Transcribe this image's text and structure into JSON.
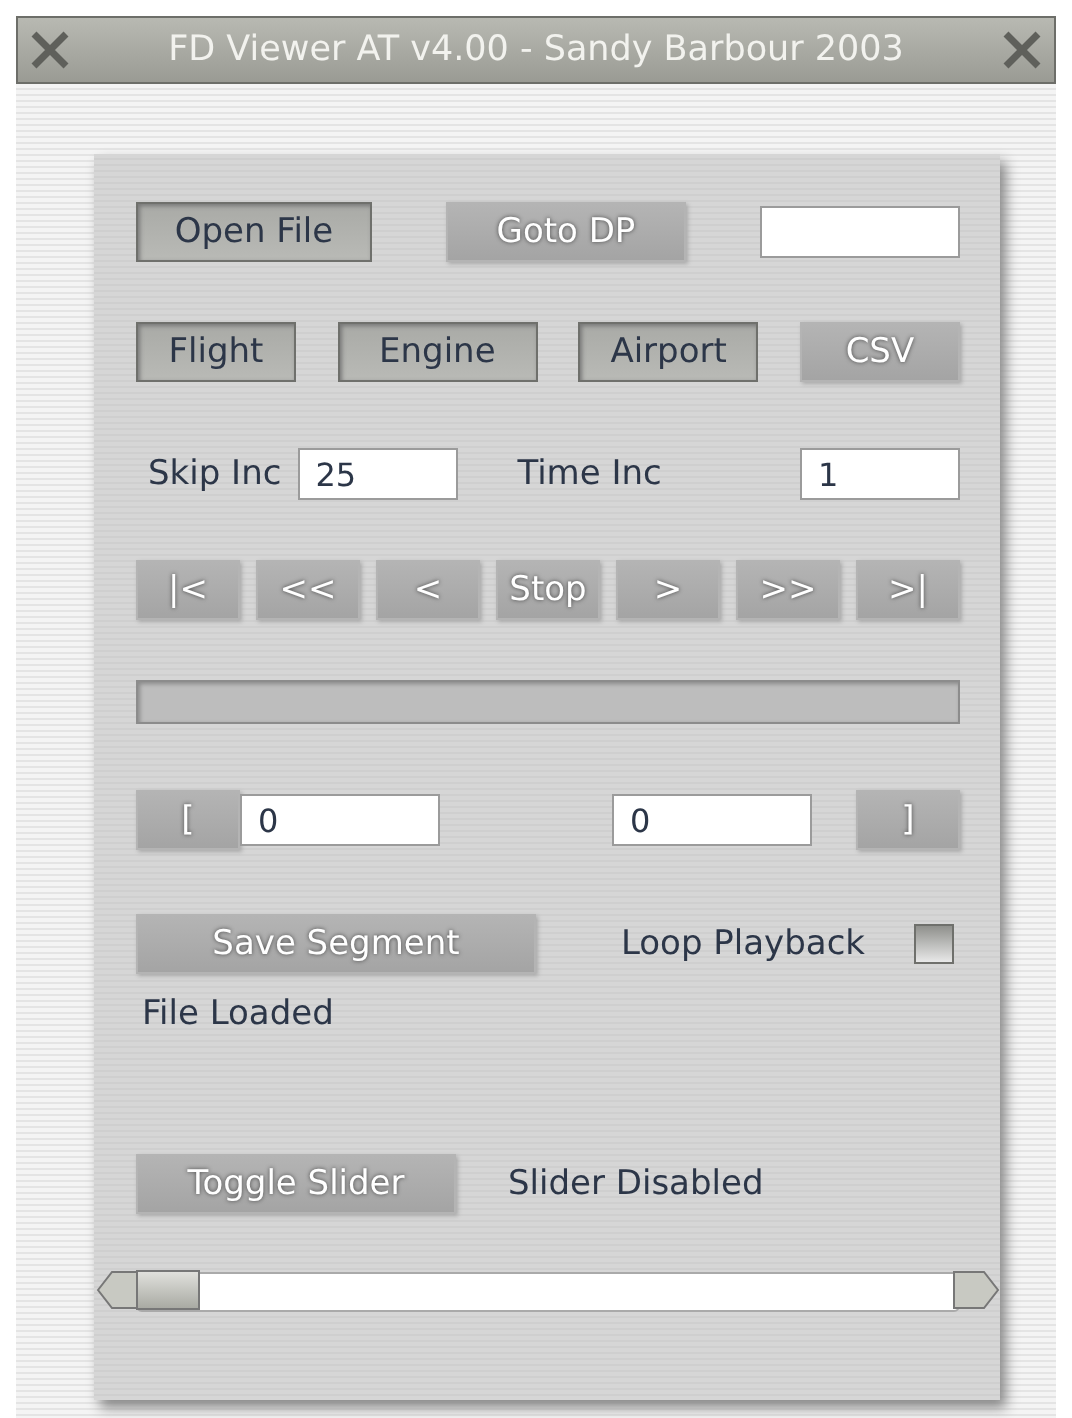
{
  "window": {
    "title": "FD Viewer AT v4.00 - Sandy Barbour 2003"
  },
  "file_row": {
    "open_button": {
      "label": "Open File",
      "disabled": false
    },
    "goto_button": {
      "label": "Goto DP",
      "disabled": true
    }
  },
  "mode_buttons": [
    {
      "label": "Flight",
      "disabled": false
    },
    {
      "label": "Engine",
      "disabled": false
    },
    {
      "label": "Airport",
      "disabled": false
    },
    {
      "label": "CSV",
      "disabled": true
    }
  ],
  "increments": [
    {
      "label": "Skip Inc",
      "value": "25"
    },
    {
      "label": "Time Inc",
      "value": "1"
    }
  ],
  "transport_buttons": [
    {
      "label": "|<",
      "disabled": true
    },
    {
      "label": "<<",
      "disabled": true
    },
    {
      "label": "<",
      "disabled": true
    },
    {
      "label": "Stop",
      "disabled": true
    },
    {
      "label": ">",
      "disabled": true
    },
    {
      "label": ">>",
      "disabled": true
    },
    {
      "label": ">|",
      "disabled": true
    }
  ],
  "progress": {
    "level": 0
  },
  "segment": {
    "start_button": {
      "label": "[",
      "disabled": true
    },
    "start_value": "0",
    "end_value": "0",
    "end_button": {
      "label": "]",
      "disabled": true
    }
  },
  "save_button": {
    "label": "Save Segment",
    "disabled": true
  },
  "loop": {
    "label": "Loop Playback",
    "checked": false
  },
  "status": "File Loaded",
  "toggle_button": {
    "label": "Toggle Slider",
    "disabled": true
  },
  "slider_status": "Slider Disabled",
  "slider": {
    "level": 0
  }
}
